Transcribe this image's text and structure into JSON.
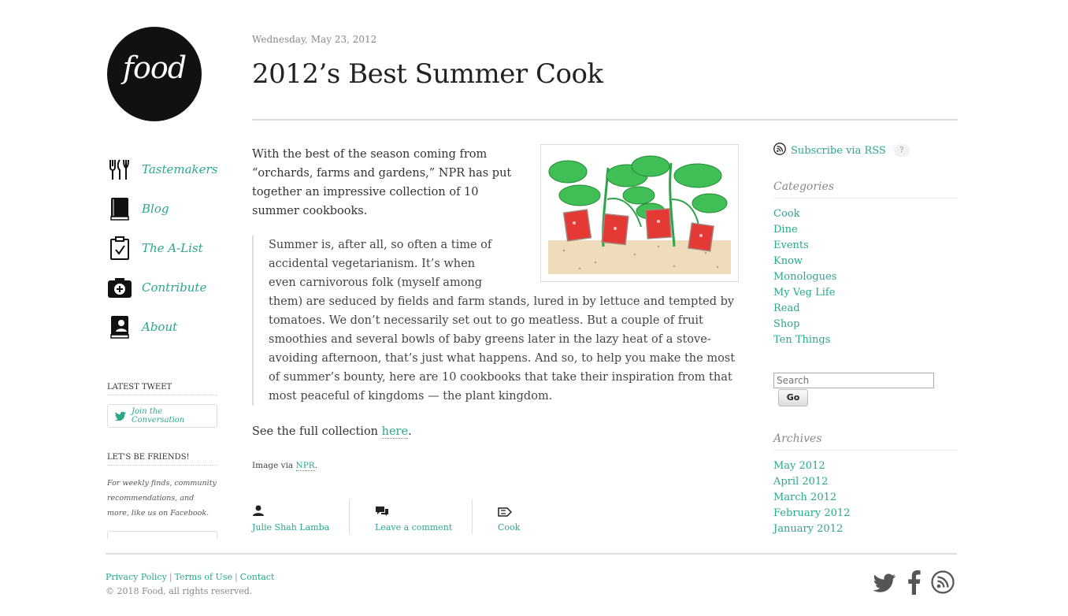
{
  "site": {
    "logo_text": "food"
  },
  "nav": {
    "items": [
      {
        "label": "Tastemakers",
        "icon": "utensils-icon"
      },
      {
        "label": "Blog",
        "icon": "book-icon"
      },
      {
        "label": "The A-List",
        "icon": "clipboard-check-icon"
      },
      {
        "label": "Contribute",
        "icon": "camera-plus-icon"
      },
      {
        "label": "About",
        "icon": "profile-book-icon"
      }
    ]
  },
  "left_sidebar": {
    "latest_tweet_heading": "LATEST TWEET",
    "tweet_button_label": "Join the Conversation",
    "friends_heading": "LET'S BE FRIENDS!",
    "friends_text": "For weekly finds, community recommendations, and more, like us on Facebook."
  },
  "post": {
    "date": "Wednesday, May 23, 2012",
    "title": "2012’s Best Summer Cook",
    "lede": "With the best of the season coming from “orchards, farms and gardens,” NPR has put together an impressive collection of 10 summer cookbooks.",
    "blockquote": "Summer is, after all, so often a time of accidental vegetarianism. It’s when even carnivorous folk (myself among them) are seduced by fields and farm stands, lured in by lettuce and tempted by tomatoes. We don’t necessarily set out to go meatless. But a couple of fruit smoothies and several bowls of baby greens later in the lazy heat of a stove-avoiding afternoon, that’s just what happens. And so, to help you make the most of summer’s bounty, here are 10 cookbooks that take their inspiration from that most peaceful of kingdoms — the plant kingdom.",
    "see_full_prefix": "See the full collection ",
    "see_full_link": "here",
    "see_full_suffix": ".",
    "image_via_prefix": "Image via ",
    "image_via_link": "NPR",
    "image_via_suffix": ".",
    "meta": {
      "author": "Julie Shah Lamba",
      "comment": "Leave a comment",
      "category": "Cook"
    }
  },
  "right_sidebar": {
    "rss_label": "Subscribe via RSS",
    "rss_help": "?",
    "categories_heading": "Categories",
    "categories": [
      "Cook",
      "Dine",
      "Events",
      "Know",
      "Monologues",
      "My Veg Life",
      "Read",
      "Shop",
      "Ten Things"
    ],
    "search_placeholder": "Search",
    "search_button": "Go",
    "archives_heading": "Archives",
    "archives": [
      "May 2012",
      "April 2012",
      "March 2012",
      "February 2012",
      "January 2012"
    ]
  },
  "footer": {
    "links": [
      "Privacy Policy",
      "Terms of Use",
      "Contact"
    ],
    "copyright": "© 2018 Food, all rights reserved."
  },
  "colors": {
    "link": "#2aa88a",
    "text": "#333333",
    "muted": "#888888"
  }
}
